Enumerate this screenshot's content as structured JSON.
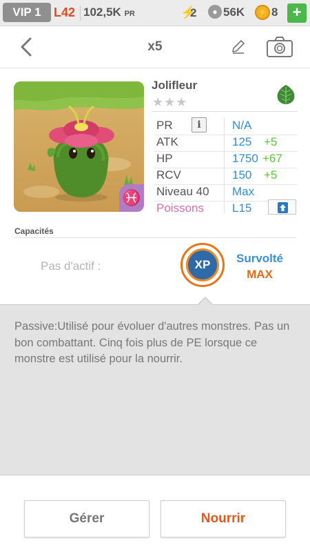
{
  "topbar": {
    "vip": "VIP 1",
    "level": "L42",
    "pr_value": "102,5K",
    "pr_unit": "PR",
    "energy": "2",
    "paw_count": "56K",
    "coins": "8",
    "plus": "+"
  },
  "nav": {
    "title": "x5"
  },
  "monster": {
    "name": "Jolifleur",
    "stars": "★★★",
    "element_icon": "leaf-icon",
    "zodiac_symbol": "♓",
    "stats": [
      {
        "label": "PR",
        "value": "N/A",
        "bonus": ""
      },
      {
        "label": "ATK",
        "value": "125",
        "bonus": "+5"
      },
      {
        "label": "HP",
        "value": "1750",
        "bonus": "+67"
      },
      {
        "label": "RCV",
        "value": "150",
        "bonus": "+5"
      },
      {
        "label": "Niveau 40",
        "value": "Max",
        "bonus": ""
      },
      {
        "label": "Poissons",
        "value": "L15",
        "bonus": ""
      }
    ]
  },
  "capacities": {
    "title": "Capacités",
    "active_text": "Pas d'actif :",
    "passive_icon_label": "XP",
    "passive_name": "Survolté",
    "passive_level": "MAX"
  },
  "description": {
    "text": "Passive:Utilisé pour évoluer d'autres monstres. Pas un bon combattant. Cinq fois plus de PE lorsque ce monstre est utilisé pour la nourrir."
  },
  "buttons": {
    "manage": "Gérer",
    "feed": "Nourrir"
  },
  "colors": {
    "accent_blue": "#2f8fd0",
    "bonus_green": "#5fc23a",
    "feed_orange": "#e4571d",
    "level_red": "#e24a20"
  }
}
